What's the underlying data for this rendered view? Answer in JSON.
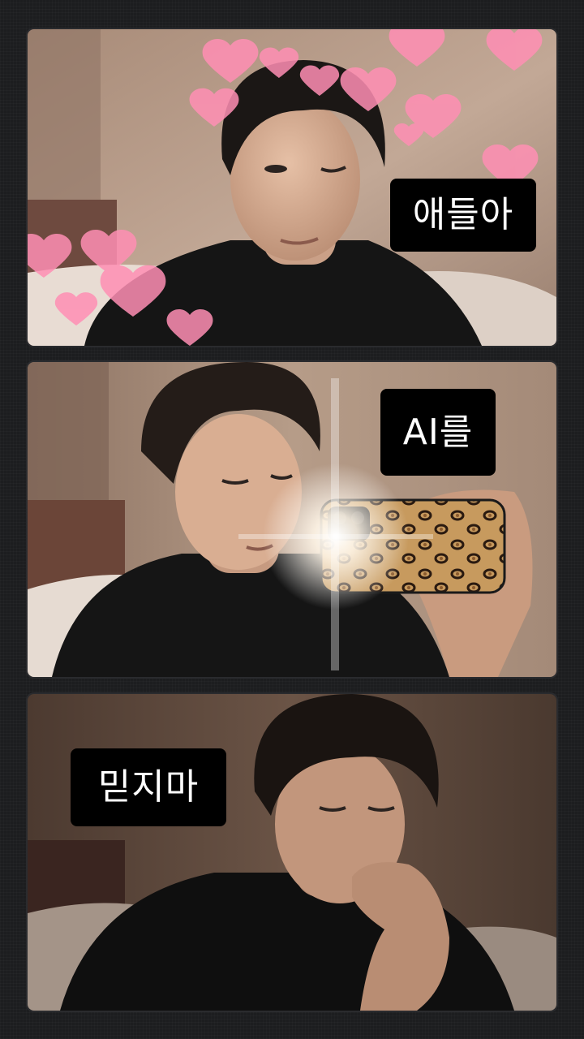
{
  "panels": [
    {
      "caption": "애들아"
    },
    {
      "caption": "AI를"
    },
    {
      "caption": "믿지마"
    }
  ],
  "colors": {
    "background": "#1c1d1f",
    "caption_bg": "#000000",
    "caption_text": "#ffffff",
    "heart": "#ff8fb4",
    "shirt": "#121212",
    "wall_warm": "#b59a86",
    "leopard_base": "#c79a5e"
  },
  "icons": {
    "hearts": "heart-sticker-icon",
    "phone": "leopard-phone-case-icon"
  }
}
